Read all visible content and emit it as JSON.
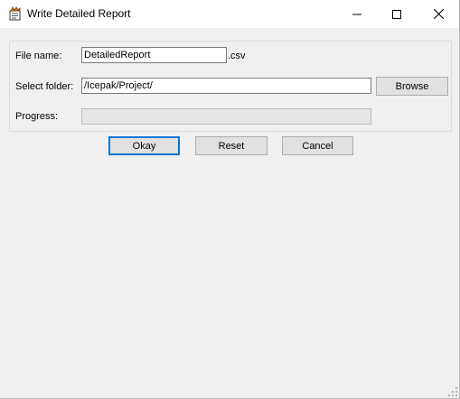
{
  "window": {
    "title": "Write Detailed Report",
    "controls": {
      "minimize_icon": "minimize-icon",
      "maximize_icon": "maximize-icon",
      "close_icon": "close-icon"
    }
  },
  "form": {
    "file_name": {
      "label": "File name:",
      "value": "DetailedReport",
      "suffix": ".csv"
    },
    "select_folder": {
      "label": "Select folder:",
      "value": "/Icepak/Project/",
      "browse_label": "Browse"
    },
    "progress": {
      "label": "Progress:",
      "value": 0
    }
  },
  "buttons": {
    "okay": "Okay",
    "reset": "Reset",
    "cancel": "Cancel"
  },
  "colors": {
    "titlebar": "#ffffff",
    "client": "#f0f0f0",
    "default_button_border": "#0078d7"
  }
}
